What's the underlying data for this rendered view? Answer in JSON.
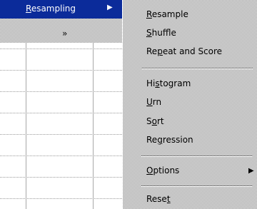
{
  "parent_menu": {
    "selected_item": {
      "mnemonic": "R",
      "rest": "esampling",
      "arrow": "▶"
    },
    "expand_chevron": "»"
  },
  "submenu": {
    "items": [
      {
        "pre": "",
        "mnemonic": "R",
        "post": "esample"
      },
      {
        "pre": "",
        "mnemonic": "S",
        "post": "huffle"
      },
      {
        "pre": "Re",
        "mnemonic": "p",
        "post": "eat and Score"
      },
      {
        "pre": "Hi",
        "mnemonic": "s",
        "post": "togram"
      },
      {
        "pre": "",
        "mnemonic": "U",
        "post": "rn"
      },
      {
        "pre": "S",
        "mnemonic": "o",
        "post": "rt"
      },
      {
        "pre": "Re",
        "mnemonic": "g",
        "post": "ression"
      },
      {
        "pre": "",
        "mnemonic": "O",
        "post": "ptions"
      },
      {
        "pre": "Rese",
        "mnemonic": "t",
        "post": ""
      }
    ],
    "options_arrow": "▶"
  }
}
